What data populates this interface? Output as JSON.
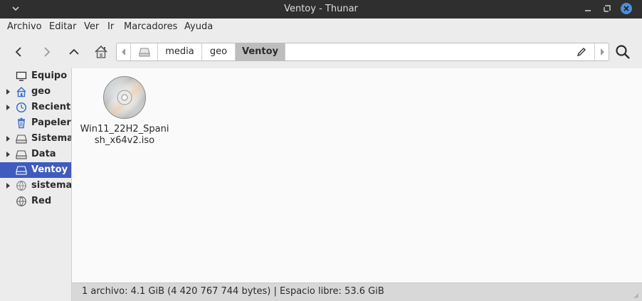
{
  "window": {
    "title": "Ventoy - Thunar"
  },
  "menu": {
    "items": [
      "Archivo",
      "Editar",
      "Ver",
      "Ir",
      "Marcadores",
      "Ayuda"
    ]
  },
  "pathbar": {
    "crumbs": [
      "media",
      "geo",
      "Ventoy"
    ],
    "active": "Ventoy"
  },
  "sidebar": {
    "items": [
      {
        "label": "Equipo",
        "icon": "computer-icon",
        "expandable": false,
        "selected": false
      },
      {
        "label": "geo",
        "icon": "home-folder-icon",
        "expandable": true,
        "selected": false
      },
      {
        "label": "Recientes",
        "icon": "clock-icon",
        "expandable": true,
        "selected": false
      },
      {
        "label": "Papelera",
        "icon": "trash-icon",
        "expandable": false,
        "selected": false
      },
      {
        "label": "Sistema de archivos",
        "icon": "drive-icon",
        "expandable": true,
        "selected": false
      },
      {
        "label": "Data",
        "icon": "drive-icon",
        "expandable": true,
        "selected": false
      },
      {
        "label": "Ventoy",
        "icon": "drive-icon",
        "expandable": false,
        "selected": true
      },
      {
        "label": "sistemas",
        "icon": "network-icon",
        "expandable": true,
        "selected": false
      },
      {
        "label": "Red",
        "icon": "network-icon",
        "expandable": false,
        "selected": false
      }
    ]
  },
  "files": [
    {
      "name": "Win11_22H2_Spanish_x64v2.iso",
      "icon": "optical-disc-icon"
    }
  ],
  "status": {
    "text": "1 archivo: 4.1 GiB (4 420 767 744 bytes)  |  Espacio libre: 53.6 GiB"
  },
  "colors": {
    "selection": "#3f5bbf",
    "titlebar": "#2f2f2f",
    "close": "#4a90d9"
  }
}
